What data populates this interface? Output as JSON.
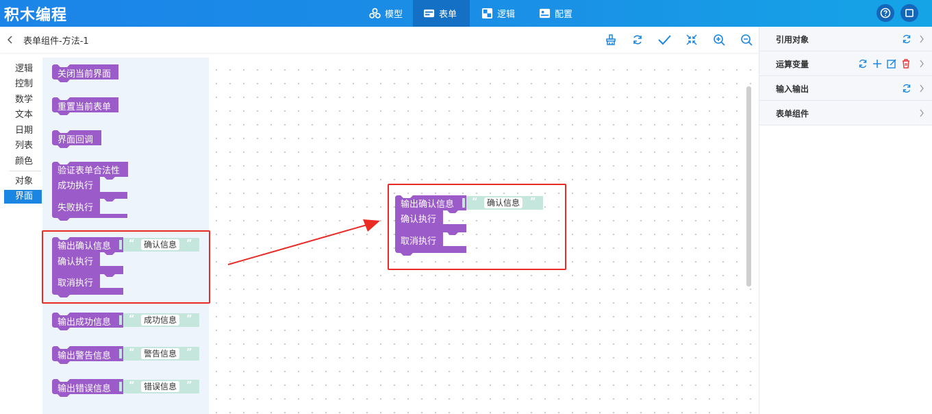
{
  "app": {
    "title": "积木编程"
  },
  "nav": {
    "tabs": [
      {
        "label": "模型",
        "icon": "model-icon"
      },
      {
        "label": "表单",
        "icon": "form-icon",
        "active": true
      },
      {
        "label": "逻辑",
        "icon": "logic-icon"
      },
      {
        "label": "配置",
        "icon": "config-icon"
      }
    ],
    "right_icons": [
      "help-icon",
      "fullscreen-icon"
    ]
  },
  "toolbar": {
    "breadcrumb": "表单组件-方法-1",
    "icons": [
      "clean-icon",
      "refresh-icon",
      "check-icon",
      "center-icon",
      "zoom-in-icon",
      "zoom-out-icon"
    ]
  },
  "categories": [
    {
      "label": "逻辑"
    },
    {
      "label": "控制"
    },
    {
      "label": "数学"
    },
    {
      "label": "文本"
    },
    {
      "label": "日期"
    },
    {
      "label": "列表"
    },
    {
      "label": "颜色"
    },
    {
      "label": "对象"
    },
    {
      "label": "界面",
      "active": true
    }
  ],
  "flyout": {
    "close_view": "关闭当前界面",
    "reset_form": "重置当前表单",
    "view_callback": "界面回调",
    "validate": {
      "title": "验证表单合法性",
      "on_success": "成功执行",
      "on_fail": "失败执行"
    },
    "confirm": {
      "title": "输出确认信息",
      "value": "确认信息",
      "on_ok": "确认执行",
      "on_cancel": "取消执行"
    },
    "success": {
      "title": "输出成功信息",
      "value": "成功信息"
    },
    "warning": {
      "title": "输出警告信息",
      "value": "警告信息"
    },
    "error": {
      "title": "输出错误信息",
      "value": "错误信息"
    }
  },
  "canvas_block": {
    "title": "输出确认信息",
    "value": "确认信息",
    "on_ok": "确认执行",
    "on_cancel": "取消执行"
  },
  "quote_open": "“",
  "quote_close": "”",
  "right_panel": {
    "sections": [
      {
        "label": "引用对象",
        "icons": [
          "refresh-icon"
        ]
      },
      {
        "label": "运算变量",
        "icons": [
          "refresh-icon",
          "add-icon",
          "edit-icon",
          "delete-icon"
        ]
      },
      {
        "label": "输入输出",
        "icons": [
          "refresh-icon"
        ]
      },
      {
        "label": "表单组件",
        "icons": []
      }
    ]
  },
  "colors": {
    "header": "#1a8ae6",
    "active_tab": "#1470c4",
    "block_purple": "#9b5bc8",
    "string_literal": "#c5e6dc",
    "highlight_red": "#ea2b25",
    "accent_blue": "#1a86e2",
    "delete_red": "#e53935"
  }
}
